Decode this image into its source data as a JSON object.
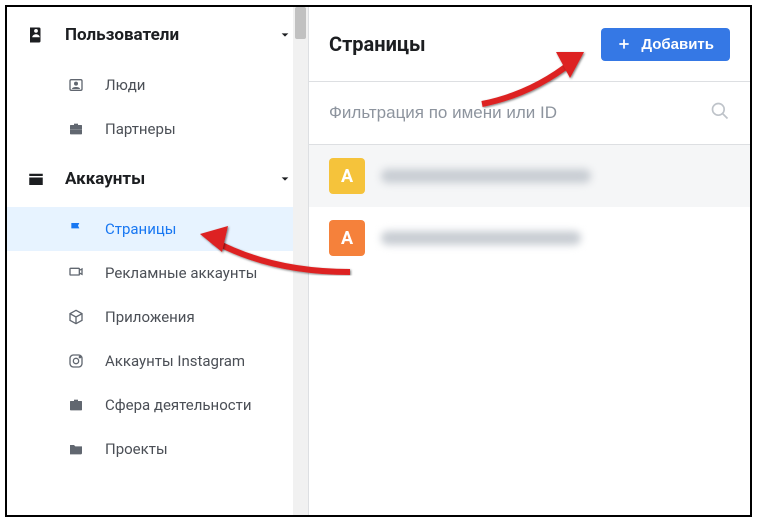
{
  "sidebar": {
    "sections": [
      {
        "label": "Пользователи",
        "items": [
          {
            "label": "Люди"
          },
          {
            "label": "Партнеры"
          }
        ]
      },
      {
        "label": "Аккаунты",
        "items": [
          {
            "label": "Страницы"
          },
          {
            "label": "Рекламные аккаунты"
          },
          {
            "label": "Приложения"
          },
          {
            "label": "Аккаунты Instagram"
          },
          {
            "label": "Сфера деятельности"
          },
          {
            "label": "Проекты"
          }
        ]
      }
    ]
  },
  "main": {
    "title": "Страницы",
    "add_button_label": "Добавить",
    "search_placeholder": "Фильтрация по имени или ID",
    "items": [
      {
        "avatar_letter": "А",
        "avatar_color": "yellow"
      },
      {
        "avatar_letter": "А",
        "avatar_color": "orange"
      }
    ]
  },
  "colors": {
    "primary": "#3578e5",
    "active_bg": "#e7f3ff"
  }
}
